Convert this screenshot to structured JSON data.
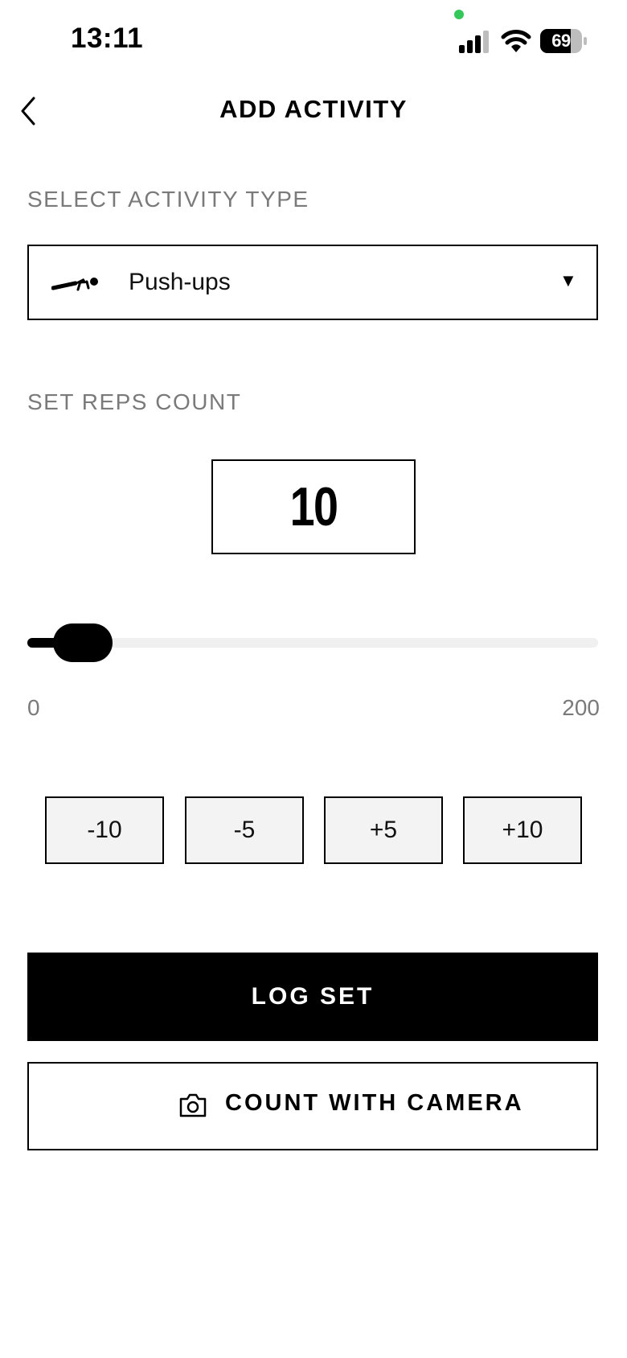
{
  "status_bar": {
    "time": "13:11",
    "battery": "69",
    "icons": [
      "cellular-signal-icon",
      "wifi-icon",
      "battery-icon"
    ]
  },
  "header": {
    "title": "ADD ACTIVITY",
    "back_icon": "chevron-left-icon"
  },
  "activity": {
    "section_label": "SELECT ACTIVITY TYPE",
    "selected": "Push-ups",
    "icon": "push-up-icon",
    "caret": "▼"
  },
  "reps": {
    "section_label": "SET REPS COUNT",
    "value": "10",
    "slider": {
      "min": 0,
      "max": 200,
      "value": 10,
      "min_label": "0",
      "max_label": "200"
    },
    "step_buttons": [
      "-10",
      "-5",
      "+5",
      "+10"
    ]
  },
  "actions": {
    "log_set": "LOG SET",
    "count_with_camera": "COUNT WITH CAMERA",
    "camera_icon": "camera-icon"
  },
  "colors": {
    "primary": "#000000",
    "muted_text": "#7a7a7a",
    "step_button_bg": "#f3f3f3",
    "track": "#f0f0f0",
    "mic_indicator": "#34c759"
  }
}
